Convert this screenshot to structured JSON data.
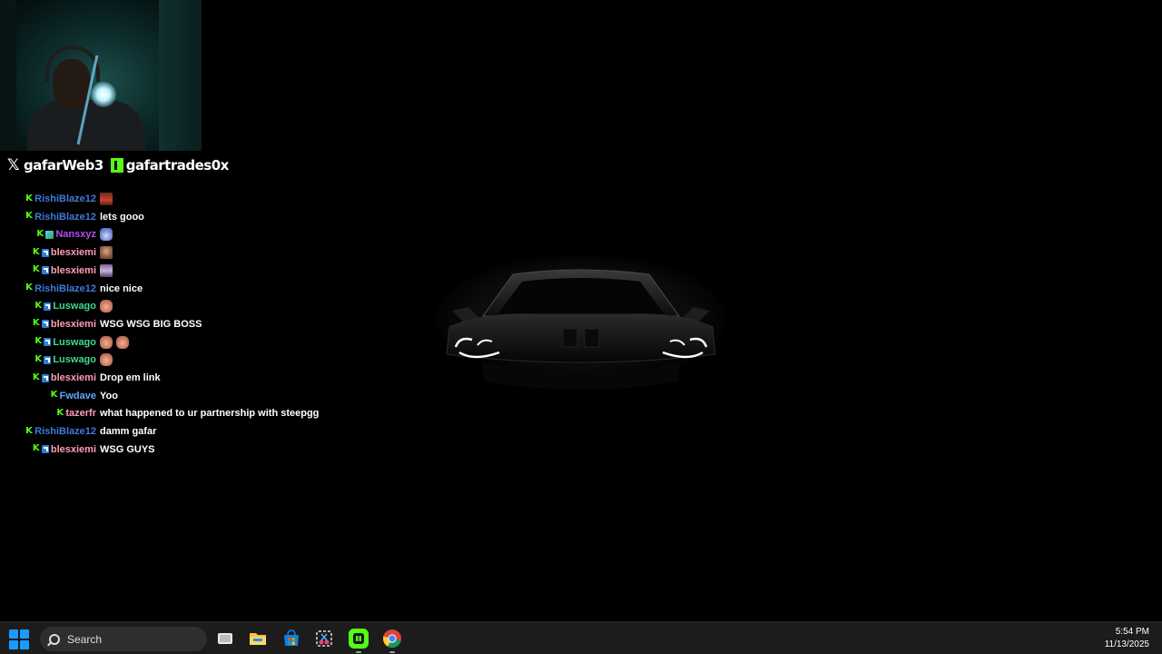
{
  "stream_overlay": {
    "socials": [
      {
        "platform": "x",
        "handle": "gafarWeb3"
      },
      {
        "platform": "kick",
        "handle": "gafartrades0x"
      }
    ]
  },
  "chat": {
    "messages": [
      {
        "user": "RishiBlaze12",
        "color": "#3e7bd8",
        "badges": [
          "kick"
        ],
        "text": "",
        "emotes": [
          "face1"
        ]
      },
      {
        "user": "RishiBlaze12",
        "color": "#3e7bd8",
        "badges": [
          "kick"
        ],
        "text": "lets gooo",
        "emotes": []
      },
      {
        "user": "Nansxyz",
        "color": "#b44cf0",
        "badges": [
          "kick",
          "gift"
        ],
        "text": "",
        "emotes": [
          "bunny"
        ]
      },
      {
        "user": "blesxiemi",
        "color": "#ff9db6",
        "badges": [
          "kick",
          "sub"
        ],
        "text": "",
        "emotes": [
          "face2"
        ]
      },
      {
        "user": "blesxiemi",
        "color": "#ff9db6",
        "badges": [
          "kick",
          "sub"
        ],
        "text": "",
        "emotes": [
          "face3"
        ]
      },
      {
        "user": "RishiBlaze12",
        "color": "#3e7bd8",
        "badges": [
          "kick"
        ],
        "text": "nice nice",
        "emotes": []
      },
      {
        "user": "Luswago",
        "color": "#42d98f",
        "badges": [
          "kick",
          "sub"
        ],
        "text": "",
        "emotes": [
          "hand"
        ]
      },
      {
        "user": "blesxiemi",
        "color": "#ff9db6",
        "badges": [
          "kick",
          "sub"
        ],
        "text": "WSG WSG BIG BOSS",
        "emotes": []
      },
      {
        "user": "Luswago",
        "color": "#42d98f",
        "badges": [
          "kick",
          "sub"
        ],
        "text": "",
        "emotes": [
          "hand",
          "hand"
        ]
      },
      {
        "user": "Luswago",
        "color": "#42d98f",
        "badges": [
          "kick",
          "sub"
        ],
        "text": "",
        "emotes": [
          "hand"
        ]
      },
      {
        "user": "blesxiemi",
        "color": "#ff9db6",
        "badges": [
          "kick",
          "sub"
        ],
        "text": "Drop em link",
        "emotes": []
      },
      {
        "user": "Fwdave",
        "color": "#5ea8ff",
        "badges": [
          "kick"
        ],
        "text": "Yoo",
        "emotes": []
      },
      {
        "user": "tazerfr",
        "color": "#ff9db6",
        "badges": [
          "kick"
        ],
        "text": "what happened to ur partnership with steepgg",
        "emotes": []
      },
      {
        "user": "RishiBlaze12",
        "color": "#3e7bd8",
        "badges": [
          "kick"
        ],
        "text": "damm gafar",
        "emotes": []
      },
      {
        "user": "blesxiemi",
        "color": "#ff9db6",
        "badges": [
          "kick",
          "sub"
        ],
        "text": "WSG GUYS",
        "emotes": []
      }
    ]
  },
  "taskbar": {
    "search_label": "Search",
    "apps": [
      "start-icon",
      "task-view-icon",
      "file-explorer-icon",
      "microsoft-store-icon",
      "snipping-tool-icon",
      "kick-app-icon",
      "chrome-icon"
    ],
    "time": "5:54 PM",
    "date": "11/13/2025"
  },
  "colors": {
    "kick_green": "#53fc18",
    "windows_blue": "#1a9bff"
  }
}
